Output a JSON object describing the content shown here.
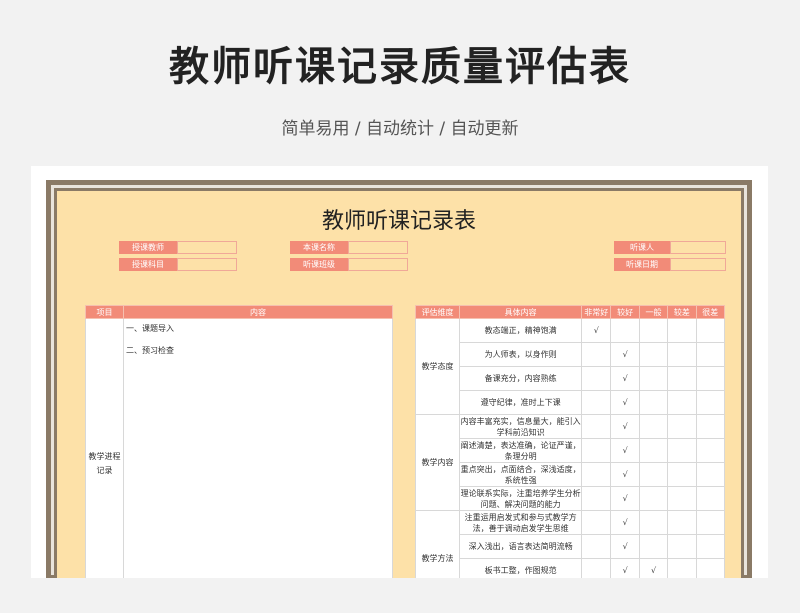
{
  "hero": {
    "title": "教师听课记录质量评估表",
    "subtitle": "简单易用 / 自动统计 / 自动更新"
  },
  "sheet": {
    "title": "教师听课记录表",
    "fields_left": [
      "授课教师",
      "授课科目"
    ],
    "fields_mid": [
      "本课名称",
      "听课班级"
    ],
    "fields_right": [
      "听课人",
      "听课日期"
    ],
    "left_headers": {
      "project": "项目",
      "content": "内容"
    },
    "project_label": "教学进程记录",
    "content_lines": [
      "一、课题导入",
      "二、预习检查"
    ],
    "right_headers": [
      "评估维度",
      "具体内容",
      "非常好",
      "较好",
      "一般",
      "较差",
      "很差"
    ],
    "check_mark": "√",
    "rows": [
      {
        "category": "教学态度",
        "rowspan": 4,
        "item": "教态端正，精神饱满",
        "checks": [
          1,
          0,
          0,
          0,
          0
        ]
      },
      {
        "item": "为人师表，以身作则",
        "checks": [
          0,
          1,
          0,
          0,
          0
        ]
      },
      {
        "item": "备课充分，内容熟练",
        "checks": [
          0,
          1,
          0,
          0,
          0
        ]
      },
      {
        "item": "遵守纪律，准时上下课",
        "checks": [
          0,
          1,
          0,
          0,
          0
        ]
      },
      {
        "category": "教学内容",
        "rowspan": 4,
        "item": "内容丰富充实，信息量大，能引入学科前沿知识",
        "checks": [
          0,
          1,
          0,
          0,
          0
        ]
      },
      {
        "item": "阐述清楚，表达准确，论证严谨，条理分明",
        "checks": [
          0,
          1,
          0,
          0,
          0
        ]
      },
      {
        "item": "重点突出，点面结合，深浅适度，系统性强",
        "checks": [
          0,
          1,
          0,
          0,
          0
        ]
      },
      {
        "item": "理论联系实际，注重培养学生分析问题、解决问题的能力",
        "checks": [
          0,
          1,
          0,
          0,
          0
        ]
      },
      {
        "category": "教学方法",
        "rowspan": 4,
        "item": "注重运用启发式和参与式教学方法，善于调动启发学生思维",
        "checks": [
          0,
          1,
          0,
          0,
          0
        ]
      },
      {
        "item": "深入浅出，语言表达简明流畅",
        "checks": [
          0,
          1,
          0,
          0,
          0
        ]
      },
      {
        "item": "板书工整，作图规范",
        "checks": [
          0,
          1,
          1,
          0,
          0
        ]
      },
      {
        "item": "",
        "checks": [
          0,
          0,
          0,
          0,
          0
        ]
      }
    ]
  }
}
